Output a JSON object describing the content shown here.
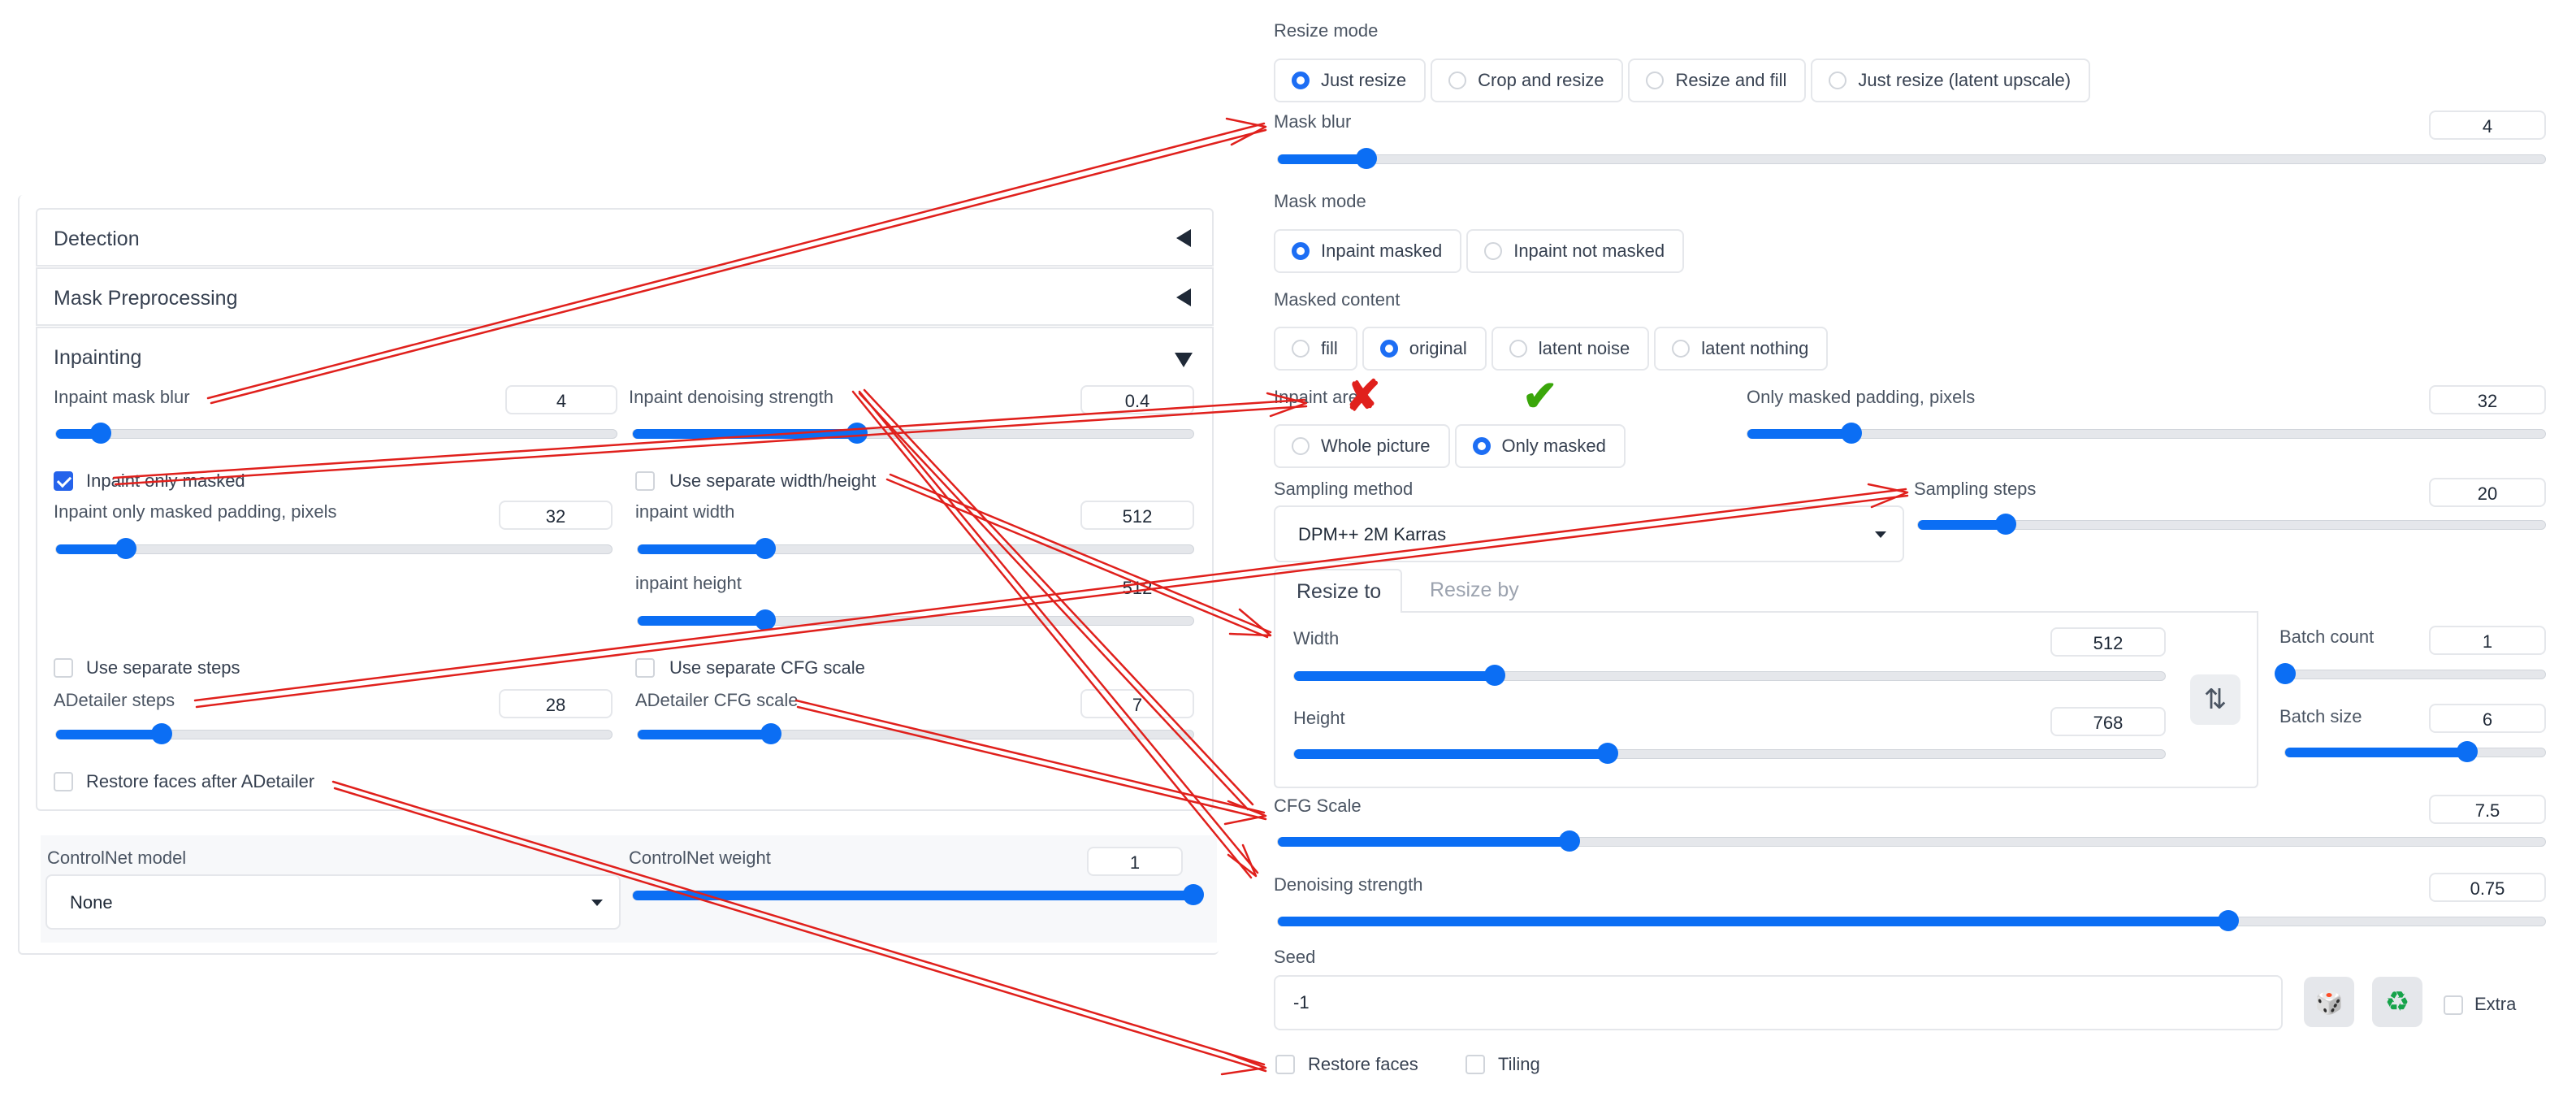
{
  "left_panel": {
    "sections": [
      {
        "title": "Detection",
        "state": "collapsed"
      },
      {
        "title": "Mask Preprocessing",
        "state": "collapsed"
      },
      {
        "title": "Inpainting",
        "state": "expanded"
      }
    ],
    "inpaint_mask_blur": {
      "label": "Inpaint mask blur",
      "value": "4",
      "fraction": 0.08
    },
    "inpaint_denoising_strength": {
      "label": "Inpaint denoising strength",
      "value": "0.4",
      "fraction": 0.4
    },
    "inpaint_only_masked": {
      "label": "Inpaint only masked",
      "checked": true
    },
    "use_separate_width_height": {
      "label": "Use separate width/height",
      "checked": false
    },
    "inpaint_only_masked_padding": {
      "label": "Inpaint only masked padding, pixels",
      "value": "32",
      "fraction": 0.125
    },
    "inpaint_width": {
      "label": "inpaint width",
      "value": "512",
      "fraction": 0.23
    },
    "inpaint_height": {
      "label": "inpaint height",
      "value": "512",
      "fraction": 0.23
    },
    "use_separate_steps": {
      "label": "Use separate steps",
      "checked": false
    },
    "use_separate_cfg_scale": {
      "label": "Use separate CFG scale",
      "checked": false
    },
    "adetailer_steps": {
      "label": "ADetailer steps",
      "value": "28",
      "fraction": 0.19
    },
    "adetailer_cfg_scale": {
      "label": "ADetailer CFG scale",
      "value": "7",
      "fraction": 0.24
    },
    "restore_faces_after_adetailer": {
      "label": "Restore faces after ADetailer",
      "checked": false
    },
    "controlnet_model": {
      "label": "ControlNet model",
      "value": "None"
    },
    "controlnet_weight": {
      "label": "ControlNet weight",
      "value": "1",
      "fraction": 1.0
    }
  },
  "right_panel": {
    "resize_mode": {
      "label": "Resize mode",
      "options": [
        "Just resize",
        "Crop and resize",
        "Resize and fill",
        "Just resize (latent upscale)"
      ],
      "selected": 0
    },
    "mask_blur": {
      "label": "Mask blur",
      "value": "4",
      "fraction": 0.07
    },
    "mask_mode": {
      "label": "Mask mode",
      "options": [
        "Inpaint masked",
        "Inpaint not masked"
      ],
      "selected": 0
    },
    "masked_content": {
      "label": "Masked content",
      "options": [
        "fill",
        "original",
        "latent noise",
        "latent nothing"
      ],
      "selected": 1
    },
    "inpaint_area": {
      "label": "Inpaint area",
      "options": [
        "Whole picture",
        "Only masked"
      ],
      "selected": 1,
      "wrong_mark": "✘",
      "right_mark": "✔"
    },
    "only_masked_padding": {
      "label": "Only masked padding, pixels",
      "value": "32",
      "fraction": 0.13
    },
    "sampling_method": {
      "label": "Sampling method",
      "value": "DPM++ 2M Karras"
    },
    "sampling_steps": {
      "label": "Sampling steps",
      "value": "20",
      "fraction": 0.14
    },
    "resize_tabs": [
      "Resize to",
      "Resize by"
    ],
    "width": {
      "label": "Width",
      "value": "512",
      "fraction": 0.23
    },
    "height": {
      "label": "Height",
      "value": "768",
      "fraction": 0.36
    },
    "swap_icon": "⇅",
    "batch_count": {
      "label": "Batch count",
      "value": "1",
      "fraction": 0.0
    },
    "batch_size": {
      "label": "Batch size",
      "value": "6",
      "fraction": 0.7
    },
    "cfg_scale": {
      "label": "CFG Scale",
      "value": "7.5",
      "fraction": 0.23
    },
    "denoising_strength": {
      "label": "Denoising strength",
      "value": "0.75",
      "fraction": 0.75
    },
    "seed": {
      "label": "Seed",
      "value": "-1",
      "dice_icon": "🎲",
      "recycle_icon": "♻",
      "extra_label": "Extra"
    },
    "restore_faces": {
      "label": "Restore faces",
      "checked": false
    },
    "tiling": {
      "label": "Tiling",
      "checked": false
    }
  },
  "colors": {
    "accent": "#0b6ef4",
    "arrow": "#e0201c",
    "check_green": "#3aa60a",
    "x_red": "#e0201c"
  }
}
